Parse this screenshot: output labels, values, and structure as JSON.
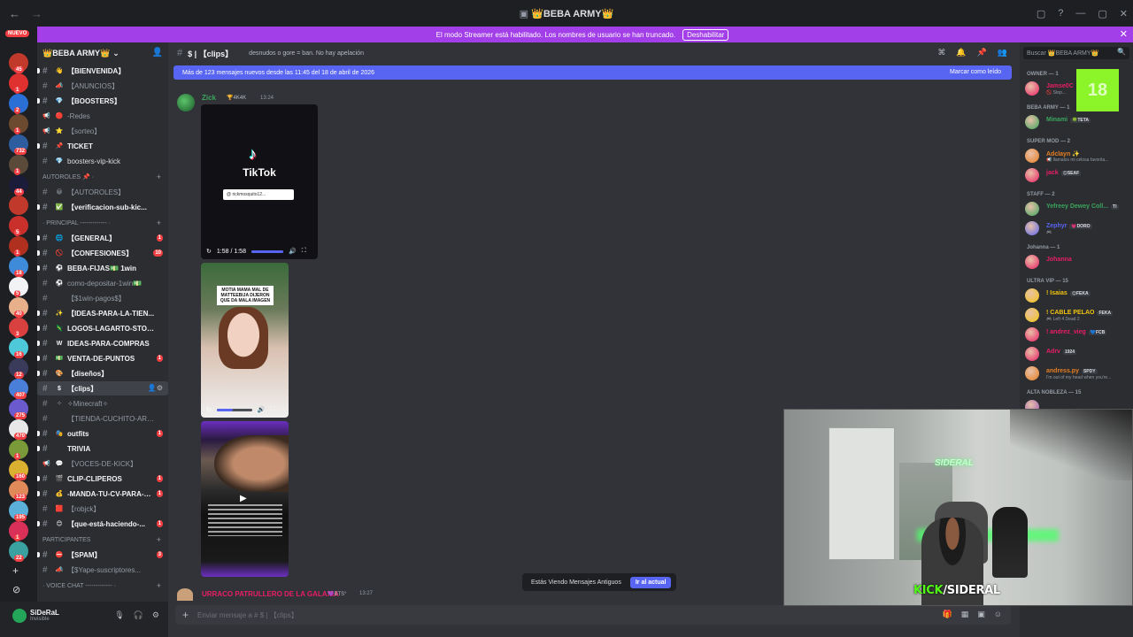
{
  "window": {
    "title": "👑BEBA ARMY👑",
    "back": "←",
    "forward": "→",
    "controls": [
      "▢",
      "?",
      "—",
      "▢",
      "✕"
    ]
  },
  "streamer_banner": {
    "text": "El modo Streamer está habilitado. Los nombres de usuario se han truncado.",
    "button": "Deshabilitar",
    "close": "✕"
  },
  "rail": {
    "new_label": "NUEVO",
    "servers": [
      {
        "color": "#c0392b",
        "badge": "45"
      },
      {
        "color": "#e03131",
        "badge": "1"
      },
      {
        "color": "#2a6fd6",
        "badge": "2"
      },
      {
        "color": "#6c4a2f",
        "badge": "1"
      },
      {
        "color": "#2d5d9f",
        "badge": "732"
      },
      {
        "color": "#5a4a3a",
        "badge": "1"
      },
      {
        "color": "#1b1b3a",
        "badge": "44"
      },
      {
        "color": "#c0392b",
        "badge": ""
      },
      {
        "color": "#c9302c",
        "badge": "5"
      },
      {
        "color": "#b03020",
        "badge": "1"
      },
      {
        "color": "#3d8bd9",
        "badge": "18"
      },
      {
        "color": "#f2f3f5",
        "badge": "5"
      },
      {
        "color": "#e8b08a",
        "badge": "40"
      },
      {
        "color": "#d94040",
        "badge": "3"
      },
      {
        "color": "#4ec9d9",
        "badge": "16"
      },
      {
        "color": "#3a3a5a",
        "badge": "12"
      },
      {
        "color": "#4a7fd9",
        "badge": "407"
      },
      {
        "color": "#6a5acd",
        "badge": "275"
      },
      {
        "color": "#e8e8e8",
        "badge": "470"
      },
      {
        "color": "#7a9a3a",
        "badge": "1"
      },
      {
        "color": "#d9b030",
        "badge": "160"
      },
      {
        "color": "#e08a5a",
        "badge": "123"
      },
      {
        "color": "#5ab0d9",
        "badge": "195"
      },
      {
        "color": "#d9305a",
        "badge": "1"
      },
      {
        "color": "#3aa0a0",
        "badge": "22"
      }
    ],
    "add_label": "+",
    "discover_label": "⊘"
  },
  "server": {
    "name": "👑BEBA ARMY👑",
    "chevron": "⌄",
    "header_icon": "👤"
  },
  "channels": [
    {
      "type": "text",
      "emoji": "👋",
      "name": "【BIENVENIDA】",
      "bold": true
    },
    {
      "type": "text",
      "emoji": "📣",
      "name": "【ANUNCIOS】",
      "bold": false
    },
    {
      "type": "text",
      "emoji": "💎",
      "name": "【BOOSTERS】",
      "bold": true
    },
    {
      "type": "announce",
      "emoji": "🔴",
      "name": "-Redes",
      "bold": false
    },
    {
      "type": "announce",
      "emoji": "⭐",
      "name": "【sorteo】",
      "bold": false
    },
    {
      "type": "text",
      "emoji": "📌",
      "name": "TICKET",
      "bold": true
    },
    {
      "type": "text",
      "emoji": "💎",
      "name": "boosters-vip-kick",
      "bold": false,
      "light": true
    },
    {
      "type": "category",
      "name": "AUTOROLES 📌 ·"
    },
    {
      "type": "text",
      "emoji": "😀",
      "name": "【AUTOROLES】",
      "bold": false
    },
    {
      "type": "text",
      "emoji": "✅",
      "name": "【verificacion-sub-kic...",
      "bold": true
    },
    {
      "type": "category",
      "name": "· PRINCIPAL ------------- ·"
    },
    {
      "type": "text",
      "emoji": "🌐",
      "name": "【GENERAL】",
      "bold": true,
      "unread": "1"
    },
    {
      "type": "text",
      "emoji": "🚫",
      "name": "【CONFESIONES】",
      "bold": true,
      "unread": "10"
    },
    {
      "type": "text",
      "emoji": "⚽",
      "name": "BEBA-FIJAS💵 1win",
      "bold": true
    },
    {
      "type": "text",
      "emoji": "⚽",
      "name": "como-depositar-1win💵",
      "bold": false
    },
    {
      "type": "text",
      "emoji": "",
      "name": "【$1win-pagos$】",
      "bold": false
    },
    {
      "type": "text",
      "emoji": "✨",
      "name": "【IDEAS-PARA-LA-TIEN...",
      "bold": true
    },
    {
      "type": "text",
      "emoji": "🦎",
      "name": "LOGOS-LAGARTO-STORE",
      "bold": true
    },
    {
      "type": "text",
      "emoji": "W",
      "name": "IDEAS-PARA-COMPRAS",
      "bold": true
    },
    {
      "type": "text",
      "emoji": "💵",
      "name": "VENTA-DE-PUNTOS",
      "bold": true,
      "unread": "1"
    },
    {
      "type": "text",
      "emoji": "🎨",
      "name": "【diseños】",
      "bold": true
    },
    {
      "type": "text",
      "emoji": "$",
      "name": "【clips】",
      "bold": true,
      "selected": true
    },
    {
      "type": "text",
      "emoji": "✧",
      "name": "✧Minecraft✧",
      "bold": false
    },
    {
      "type": "text",
      "emoji": "",
      "name": "【TIENDA-CUCHITO-ARM...",
      "bold": false
    },
    {
      "type": "text",
      "emoji": "🎭",
      "name": "outfits",
      "bold": true,
      "unread": "1"
    },
    {
      "type": "text",
      "emoji": "",
      "name": "TRIVIA",
      "bold": true
    },
    {
      "type": "announce",
      "emoji": "💬",
      "name": "【VOCES-DE-KICK】",
      "bold": false
    },
    {
      "type": "text",
      "emoji": "🎬",
      "name": "CLIP-CLIPEROS",
      "bold": true,
      "unread": "1"
    },
    {
      "type": "text",
      "emoji": "💰",
      "name": "-MANDA-TU-CV-PARA-MOD",
      "bold": true,
      "unread": "1"
    },
    {
      "type": "text",
      "emoji": "🟥",
      "name": "【robjck】",
      "bold": false
    },
    {
      "type": "text",
      "emoji": "😊",
      "name": "【que-está-haciendo-...",
      "bold": true,
      "unread": "1"
    },
    {
      "type": "category",
      "name": "PARTICIPANTES"
    },
    {
      "type": "text",
      "emoji": "⛔",
      "name": "【SPAM】",
      "bold": true,
      "unread": "3"
    },
    {
      "type": "text",
      "emoji": "📣",
      "name": "【$Yape-suscriptores...",
      "bold": false
    },
    {
      "type": "category",
      "name": "· VOICE CHAT ------------- ·"
    }
  ],
  "user": {
    "name": "SiDeRaL",
    "status": "Invisible",
    "mic": "🎙",
    "headset": "🎧",
    "settings": "⚙"
  },
  "channel_header": {
    "hash": "#",
    "name": "$ | 【clips】",
    "topic": "desnudos o gore = ban. No hay apelación",
    "tools": [
      "⌘",
      "🔔",
      "📌",
      "👥"
    ]
  },
  "new_messages": {
    "text": "Más de 123 mensajes nuevos desde las 11:45 del 18 de abril de 2026",
    "mark_read": "Marcar como leído"
  },
  "messages": [
    {
      "author": "Zick",
      "author_color": "#3ba55c",
      "role_tag": "🏆4K4K",
      "time": "13:24",
      "video1": {
        "label": "TikTok",
        "search": "@ rickmosquito12...",
        "time": "1:58 / 1:58",
        "progress": 1.0
      },
      "video2": {
        "caption": "MOTIA MAMA MAL DE MATTEEBIJA DIJERON QUE DA MALA IMAGEN",
        "progress": 0.45
      },
      "video3": {
        "progress": 0.0
      }
    },
    {
      "author": "URRACO PATRULLERO DE LA GALAXIA",
      "author_color": "#e91e63",
      "role_tag": "💜BTS°",
      "time": "13:27"
    }
  ],
  "old_messages": {
    "text": "Estás Viendo Mensajes Antiguos",
    "button": "Ir al actual"
  },
  "composer": {
    "placeholder": "Enviar mensaje a # $ | 【clips】",
    "add": "+"
  },
  "member_search": {
    "placeholder": "Buscar 👑BEBA ARMY👑",
    "icon": "🔍"
  },
  "member_groups": [
    {
      "title": "OWNER — 1",
      "members": [
        {
          "name": "Jamse0C",
          "color": "#e91e63",
          "sub": "🚫 Stop..."
        }
      ]
    },
    {
      "title": "BEBA ARMY — 1",
      "members": [
        {
          "name": "Minami",
          "color": "#3ba55c",
          "tag": "🍀TETA"
        }
      ]
    },
    {
      "title": "SUPER MOD — 2",
      "members": [
        {
          "name": "Adclayn ✨",
          "color": "#e67e22",
          "sub": "📢 llamalos mi celosa favorita..."
        },
        {
          "name": "jack",
          "color": "#e91e63",
          "tag": "😊SEAF"
        }
      ]
    },
    {
      "title": "STAFF — 2",
      "members": [
        {
          "name": "Yefreey Dewey Coll...",
          "color": "#3ba55c",
          "tag": "TI"
        },
        {
          "name": "Zephyr",
          "color": "#5865f2",
          "tag": "💗DORO",
          "sub": "🎮"
        }
      ]
    },
    {
      "title": "Johanna — 1",
      "members": [
        {
          "name": "Johanna",
          "color": "#e91e63"
        }
      ]
    },
    {
      "title": "ULTRA VIP — 15",
      "members": [
        {
          "name": "! Isaias",
          "color": "#f1c40f",
          "tag": "😊FEKA"
        },
        {
          "name": "! CABLE PELAO",
          "color": "#f1c40f",
          "tag": "FEKA",
          "sub": "🎮 Left 4 Dead 2"
        },
        {
          "name": "! andrez_vieg",
          "color": "#e91e63",
          "tag": "💙FCB"
        },
        {
          "name": "Adrv",
          "color": "#e91e63",
          "tag": "1924"
        },
        {
          "name": "andress.py",
          "color": "#e67e22",
          "tag": "SPDY",
          "sub": "I'm out of my head when you're..."
        }
      ]
    },
    {
      "title": "ALTA NOBLEZA — 15",
      "members": [
        {
          "name": "",
          "color": "#9b59b6"
        }
      ]
    }
  ],
  "overlay": {
    "age_badge": "18",
    "kick_text": "KICK",
    "kick_name": "/SIDERAL",
    "webcam_label": "SIDERAL"
  }
}
